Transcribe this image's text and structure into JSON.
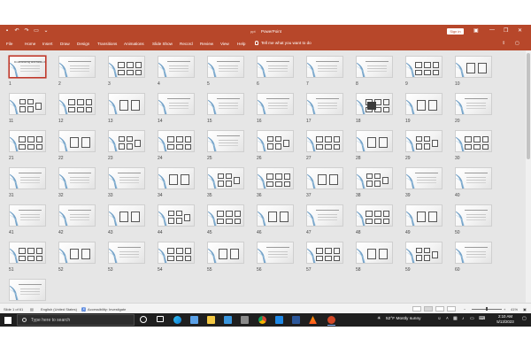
{
  "window": {
    "file_name": "ppt",
    "app_title": "PowerPoint",
    "signin_label": "Sign in",
    "controls": [
      "—",
      "❐",
      "✕"
    ]
  },
  "ribbon": {
    "tabs": [
      "File",
      "Home",
      "Insert",
      "Draw",
      "Design",
      "Transitions",
      "Animations",
      "Slide Show",
      "Record",
      "Review",
      "View",
      "Help"
    ],
    "tell_me": "Tell me what you want to do",
    "share_icons": [
      "share-icon",
      "comments-icon"
    ]
  },
  "sorter": {
    "slide_numbers": [
      1,
      2,
      3,
      4,
      5,
      6,
      7,
      8,
      9,
      10,
      11,
      12,
      13,
      14,
      15,
      16,
      17,
      18,
      19,
      20,
      21,
      22,
      23,
      24,
      25,
      26,
      27,
      28,
      29,
      30,
      31,
      32,
      33,
      34,
      35,
      36,
      37,
      38,
      39,
      40,
      41,
      42,
      43,
      44,
      45,
      46,
      47,
      48,
      49,
      50,
      51,
      52,
      53,
      54,
      55,
      56,
      57,
      58,
      59,
      60,
      61
    ],
    "selected_slide": 1,
    "slide_one_title": "Dimensioning and Assembly"
  },
  "status": {
    "slide_count": "Slide 1 of 61",
    "language": "English (United States)",
    "accessibility": "Accessibility: Investigate",
    "zoom": "41%"
  },
  "taskbar": {
    "search_placeholder": "Type here to search",
    "weather": "52°F  Mostly sunny",
    "time": "2:10 AM",
    "date": "5/13/2023"
  },
  "colors": {
    "accent": "#b7472a",
    "selected_border": "#c0392b",
    "sorter_bg": "#e6e6e6"
  }
}
